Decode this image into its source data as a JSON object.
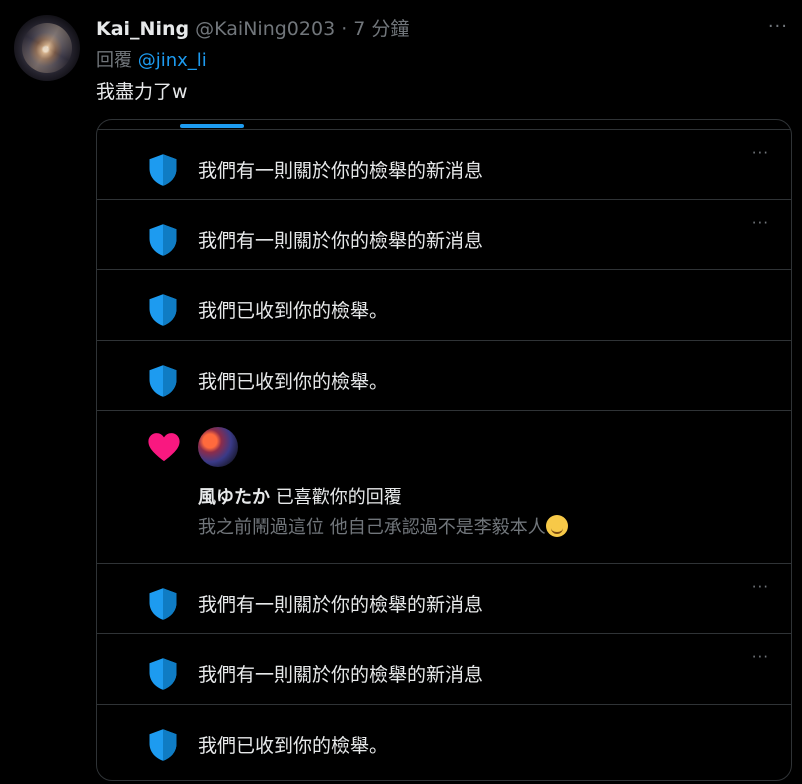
{
  "tweet": {
    "display_name": "Kai_Ning",
    "handle": "@KaiNing0203",
    "separator": "·",
    "time": "7 分鐘",
    "more": "···",
    "reply_prefix": "回覆",
    "reply_mention": "@jinx_li",
    "text": "我盡力了w"
  },
  "notifications": [
    {
      "type": "shield",
      "text": "我們有一則關於你的檢舉的新消息",
      "has_more": true
    },
    {
      "type": "shield",
      "text": "我們有一則關於你的檢舉的新消息",
      "has_more": true
    },
    {
      "type": "shield",
      "text": "我們已收到你的檢舉。",
      "has_more": false
    },
    {
      "type": "shield",
      "text": "我們已收到你的檢舉。",
      "has_more": false
    },
    {
      "type": "like",
      "liker_name": "風ゆたか",
      "action": "已喜歡你的回覆",
      "liked_text": "我之前鬧過這位 他自己承認過不是李毅本人",
      "emoji": "smirking-face"
    },
    {
      "type": "shield",
      "text": "我們有一則關於你的檢舉的新消息",
      "has_more": true
    },
    {
      "type": "shield",
      "text": "我們有一則關於你的檢舉的新消息",
      "has_more": true
    },
    {
      "type": "shield",
      "text": "我們已收到你的檢舉。",
      "has_more": false
    }
  ],
  "more_label": "···",
  "colors": {
    "accent": "#1d9bf0",
    "like": "#f91880",
    "background": "#000000",
    "border": "#2f3336",
    "muted": "#71767b"
  }
}
